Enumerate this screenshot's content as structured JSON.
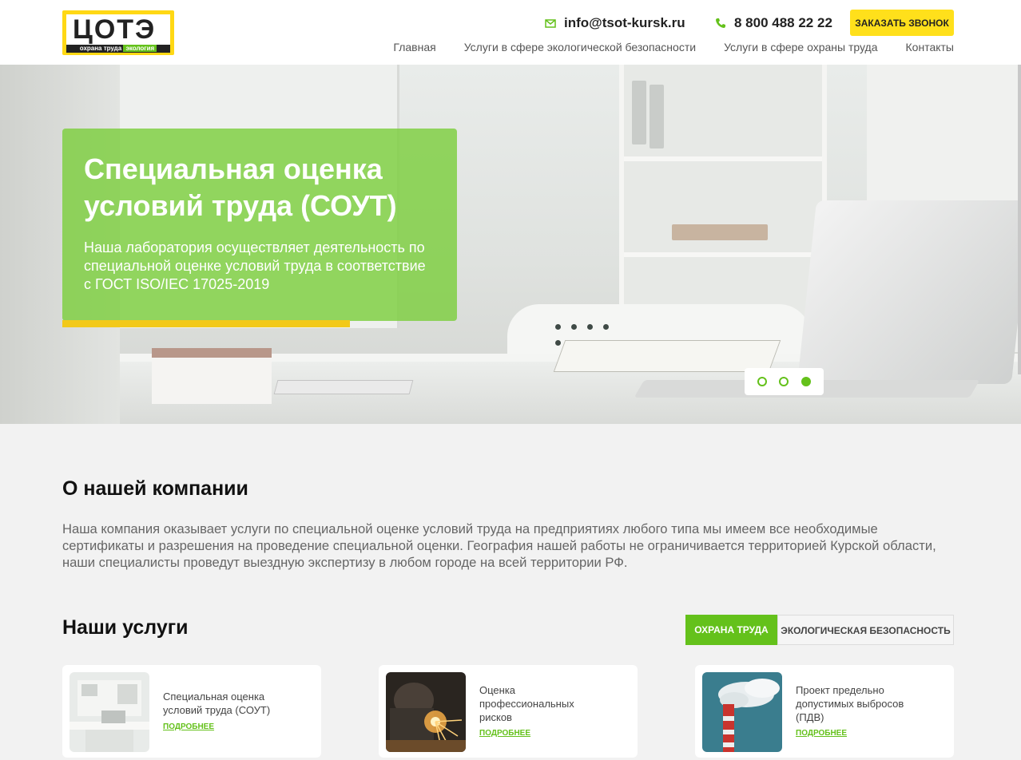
{
  "header": {
    "logo_text": "ЦОТЭ",
    "logo_sub_left": "охрана труда",
    "logo_sub_right": "экология",
    "email": "info@tsot-kursk.ru",
    "phone": "8 800 488 22 22",
    "call_button": "Заказать звонок",
    "nav": [
      {
        "label": "Главная"
      },
      {
        "label": "Услуги в сфере экологической безопасности"
      },
      {
        "label": "Услуги в сфере охраны труда"
      },
      {
        "label": "Контакты"
      }
    ]
  },
  "hero": {
    "title": "Специальная оценка условий труда (СОУТ)",
    "text": "Наша лаборатория осуществляет деятельность по специальной оценке условий труда в соответствие с ГОСТ ISO/IEC 17025-2019",
    "slides": 3,
    "active_slide": 3
  },
  "about": {
    "title": "О нашей компании",
    "text": "Наша компания оказывает услуги по специальной оценке условий труда на предприятиях любого типа мы имеем все необходимые сертификаты и разрешения на проведение специальной оценки. География нашей работы не ограничивается территорией Курской области, наши специалисты проведут выездную экспертизу в любом городе на всей территории РФ."
  },
  "services": {
    "title": "Наши услуги",
    "tabs": [
      {
        "label": "Охрана труда",
        "active": true
      },
      {
        "label": "Экологическая безопасность",
        "active": false
      }
    ],
    "cards": [
      {
        "title": "Специальная оценка условий труда (СОУТ)",
        "more": "Подробнее"
      },
      {
        "title": "Оценка профессиональных рисков",
        "more": "Подробнее"
      },
      {
        "title": "Проект предельно допустимых выбросов (ПДВ)",
        "more": "Подробнее"
      }
    ]
  },
  "colors": {
    "accent_green": "#64c11b",
    "accent_yellow": "#ffe01b"
  }
}
